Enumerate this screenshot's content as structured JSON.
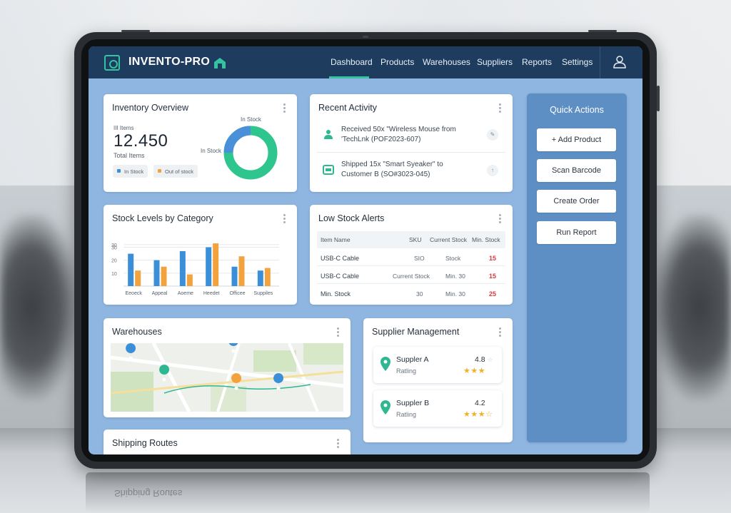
{
  "app": {
    "brand": "INVENTO-PRO"
  },
  "nav": {
    "items": [
      {
        "label": "Dashboard",
        "active": true
      },
      {
        "label": "Products"
      },
      {
        "label": "Warehouses"
      },
      {
        "label": "Suppliers"
      },
      {
        "label": "Reports"
      },
      {
        "label": "Settings"
      }
    ],
    "icons": {
      "logo": "scan-box-icon",
      "home": "warehouse-home-icon",
      "user": "user-icon"
    },
    "colors": {
      "bar": "#1d3c5e",
      "accent": "#34c3a3"
    }
  },
  "inventory_overview": {
    "title": "Inventory Overview",
    "top_label": "III Items",
    "total": "12.450",
    "total_label": "Total Items",
    "donut_label_top": "In Stock",
    "donut_label_side": "In Stock",
    "legend": [
      "In Stock",
      "Out of stock"
    ],
    "donut_colors": {
      "in_stock": "#2ec68e",
      "out_of_stock": "#4a90d9"
    }
  },
  "recent_activity": {
    "title": "Recent Activity",
    "items": [
      {
        "line1": "Received 50x \"Wireless Mouse from",
        "line2": "'TechLnk (POF2023-607)",
        "icon": "user-receive-icon",
        "badge": "✎"
      },
      {
        "line1": "Shipped 15x \"Smart Syeaker\" to",
        "line2": "Customer B (SO#3023-045)",
        "icon": "shipment-box-icon",
        "badge": "↑"
      }
    ]
  },
  "stock_levels": {
    "title": "Stock Levels by Category"
  },
  "chart_data": {
    "type": "bar",
    "title": "Stock Levels by Category",
    "categories": [
      "Eeoeck",
      "Appeal",
      "Aoeme",
      "Heedet",
      "Officee",
      "Suppiles"
    ],
    "series": [
      {
        "values": [
          25,
          20,
          27,
          30,
          15,
          12
        ],
        "color": "#3b8fd9"
      },
      {
        "values": [
          12,
          15,
          9,
          33,
          23,
          14
        ],
        "color": "#f2a33d"
      }
    ],
    "yticks": [
      "10",
      "20",
      "30"
    ],
    "ytick_values": [
      10,
      20,
      30
    ],
    "top_tick": "30",
    "ylim": [
      0,
      38
    ],
    "grid": true
  },
  "low_stock": {
    "title": "Low Stock Alerts",
    "headers": [
      "Item Name",
      "SKU",
      "Current Stock",
      "Min. Stock"
    ],
    "rows": [
      {
        "name": "USB-C Cable",
        "sku": "SIO",
        "current": "Stock",
        "min": "15"
      },
      {
        "name": "USB-C Cable",
        "sku": "Current Stock",
        "current": "Min. 30",
        "min": "15"
      },
      {
        "name": "Min. Stock",
        "sku": "30",
        "current": "Min. 30",
        "min": "25"
      }
    ]
  },
  "quick_actions": {
    "title": "Quick Actions",
    "buttons": [
      "+ Add Product",
      "Scan Barcode",
      "Create Order",
      "Run Report"
    ]
  },
  "warehouses": {
    "title": "Warehouses",
    "icon": "map-icon"
  },
  "supplier_management": {
    "title": "Supplier Management",
    "suppliers": [
      {
        "name": "Suppler A",
        "sub": "Ratling",
        "score": "4.8",
        "score_suffix": "☆",
        "stars": "★★★"
      },
      {
        "name": "Suppler B",
        "sub": "Ratling",
        "score": "4.2",
        "score_suffix": "",
        "stars": "★★★☆"
      }
    ]
  },
  "shipping_routes": {
    "title": "Shipping Routes"
  }
}
